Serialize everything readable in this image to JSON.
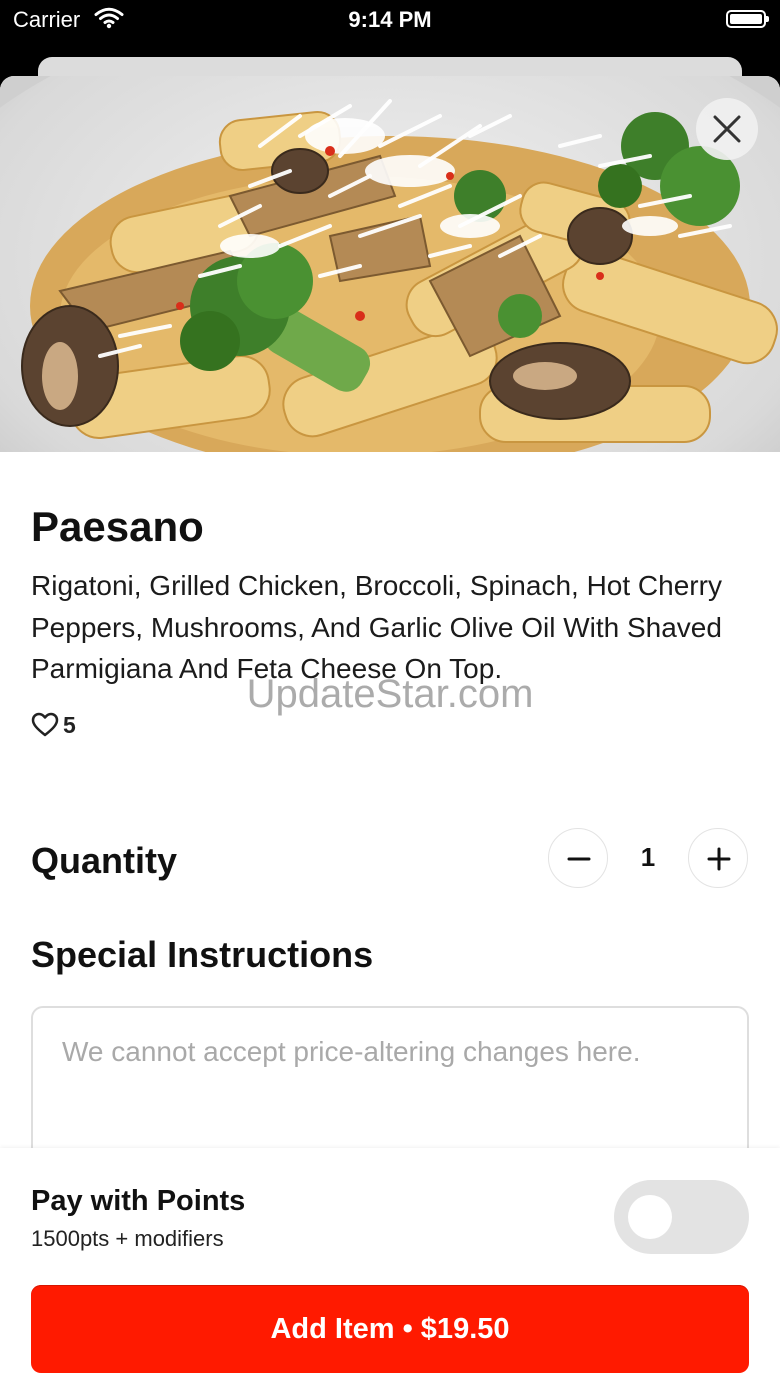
{
  "status_bar": {
    "carrier": "Carrier",
    "time": "9:14 PM",
    "wifi_icon": "wifi-icon",
    "battery_icon": "battery-icon"
  },
  "item": {
    "name": "Paesano",
    "description": "Rigatoni, Grilled Chicken, Broccoli, Spinach, Hot Cherry Peppers, Mushrooms, And Garlic Olive Oil With Shaved Parmigiana And Feta Cheese On Top.",
    "likes": "5",
    "like_icon": "heart-outline-icon",
    "close_icon": "close-icon"
  },
  "watermark": "UpdateStar.com",
  "quantity": {
    "label": "Quantity",
    "value": "1",
    "minus_icon": "minus-icon",
    "plus_icon": "plus-icon"
  },
  "special_instructions": {
    "label": "Special Instructions",
    "value": "",
    "placeholder": "We cannot accept price-altering changes here."
  },
  "points": {
    "title": "Pay with Points",
    "subtitle": "1500pts + modifiers",
    "toggle_on": false
  },
  "add_button": {
    "label": "Add Item • $19.50"
  },
  "colors": {
    "accent": "#ff1a00",
    "toggle_off": "#e3e3e3"
  }
}
